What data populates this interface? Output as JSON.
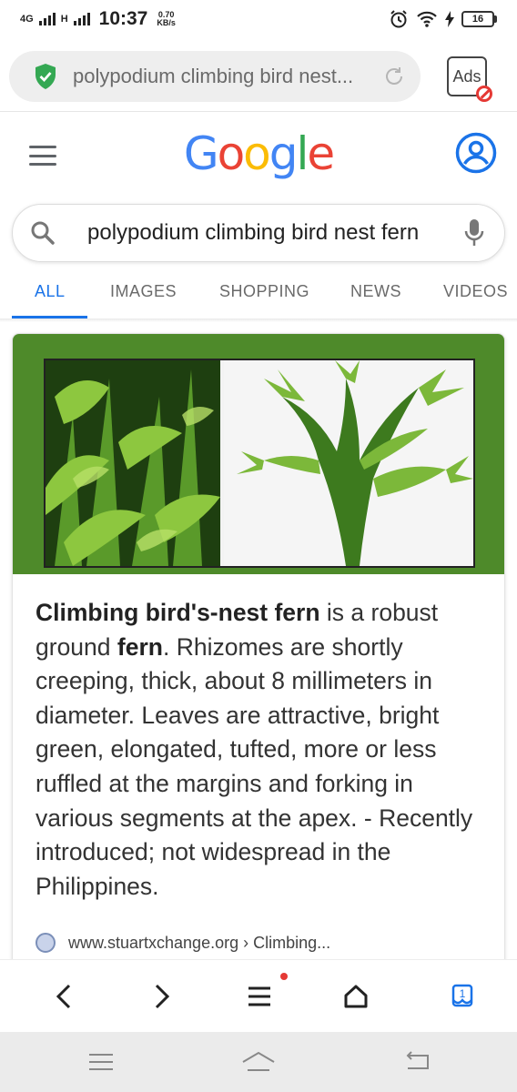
{
  "status": {
    "network": "4G",
    "network2": "H",
    "time": "10:37",
    "speed_value": "0.70",
    "speed_unit": "KB/s",
    "battery": "16"
  },
  "browser": {
    "url_text": "polypodium climbing bird nest...",
    "ads_label": "Ads"
  },
  "logo": {
    "letters": [
      "G",
      "o",
      "o",
      "g",
      "l",
      "e"
    ],
    "colors": [
      "#4285F4",
      "#EA4335",
      "#FBBC05",
      "#4285F4",
      "#34A853",
      "#EA4335"
    ]
  },
  "search": {
    "query": "polypodium climbing bird nest fern"
  },
  "tabs": [
    {
      "label": "ALL"
    },
    {
      "label": "IMAGES"
    },
    {
      "label": "SHOPPING"
    },
    {
      "label": "NEWS"
    },
    {
      "label": "VIDEOS"
    }
  ],
  "result": {
    "term_bold": "Climbing bird's-nest fern",
    "text_a": " is a robust ground ",
    "term_bold_2": "fern",
    "text_b": ". Rhizomes are shortly creeping, thick, about 8 millimeters in diameter. Leaves are attractive, bright green, elongated, tufted, more or less ruffled at the margins and forking in various segments at the apex. - Recently introduced; not widespread in the Philippines.",
    "source": "www.stuartxchange.org › Climbing..."
  },
  "toolbar": {
    "tab_count": "1"
  },
  "colors": {
    "accent": "#1a73e8",
    "secure_green": "#34a853",
    "image_border_green": "#4e8a2a"
  }
}
